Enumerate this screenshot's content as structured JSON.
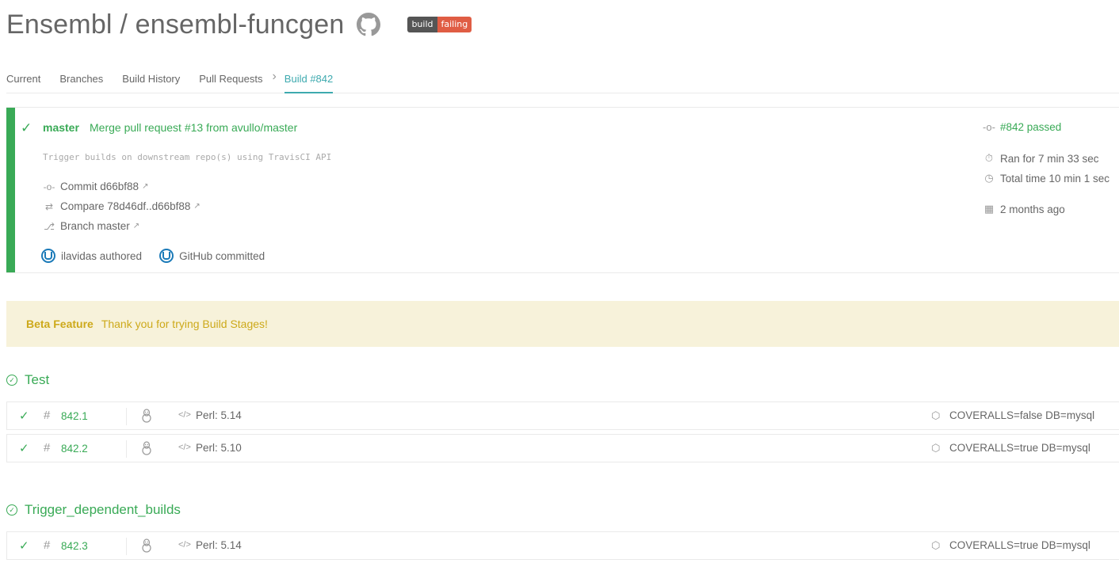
{
  "header": {
    "title": "Ensembl / ensembl-funcgen",
    "github_icon": "github-icon",
    "badge_left": "build",
    "badge_right": "failing",
    "badge_colors": {
      "left": "#555555",
      "right": "#e05d44"
    }
  },
  "tabs": [
    {
      "label": "Current"
    },
    {
      "label": "Branches"
    },
    {
      "label": "Build History"
    },
    {
      "label": "Pull Requests"
    },
    {
      "label": "Build #842",
      "active": true
    }
  ],
  "build": {
    "branch": "master",
    "message": "Merge pull request #13 from avullo/master",
    "description": "Trigger builds on downstream repo(s) using TravisCI API",
    "commit": "Commit d66bf88",
    "compare": "Compare 78d46df..d66bf88",
    "branch_link": "Branch master",
    "author": "ilavidas authored",
    "committer": "GitHub committed",
    "status": "#842 passed",
    "ran_for": "Ran for 7 min 33 sec",
    "total_time": "Total time 10 min 1 sec",
    "date": "2 months ago",
    "status_color": "#39aa56"
  },
  "beta": {
    "label": "Beta Feature",
    "message": "Thank you for trying Build Stages!"
  },
  "stages": [
    {
      "title": "Test",
      "jobs": [
        {
          "number": "842.1",
          "language": "Perl: 5.14",
          "env": "COVERALLS=false DB=mysql"
        },
        {
          "number": "842.2",
          "language": "Perl: 5.10",
          "env": "COVERALLS=true DB=mysql"
        }
      ]
    },
    {
      "title": "Trigger_dependent_builds",
      "jobs": [
        {
          "number": "842.3",
          "language": "Perl: 5.14",
          "env": "COVERALLS=true DB=mysql"
        }
      ]
    }
  ]
}
